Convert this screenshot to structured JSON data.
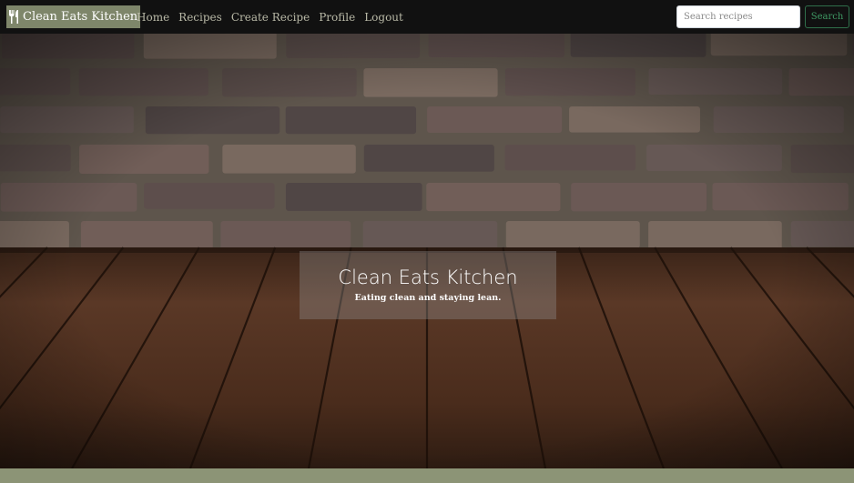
{
  "navbar": {
    "brand_label": "Clean Eats Kitchen",
    "brand_icon": "utensils-icon",
    "links": [
      {
        "label": "Home"
      },
      {
        "label": "Recipes"
      },
      {
        "label": "Create Recipe"
      },
      {
        "label": "Profile"
      },
      {
        "label": "Logout"
      }
    ],
    "search": {
      "placeholder": "Search recipes",
      "value": "",
      "button_label": "Search"
    }
  },
  "hero": {
    "title": "Clean Eats Kitchen",
    "tagline": "Eating clean and staying lean.",
    "background": "brick wall over wooden floor"
  },
  "colors": {
    "navbar_bg": "#111111",
    "brand_bg": "#7e866a",
    "accent": "#8c9476",
    "search_button": "#3f9a65"
  }
}
